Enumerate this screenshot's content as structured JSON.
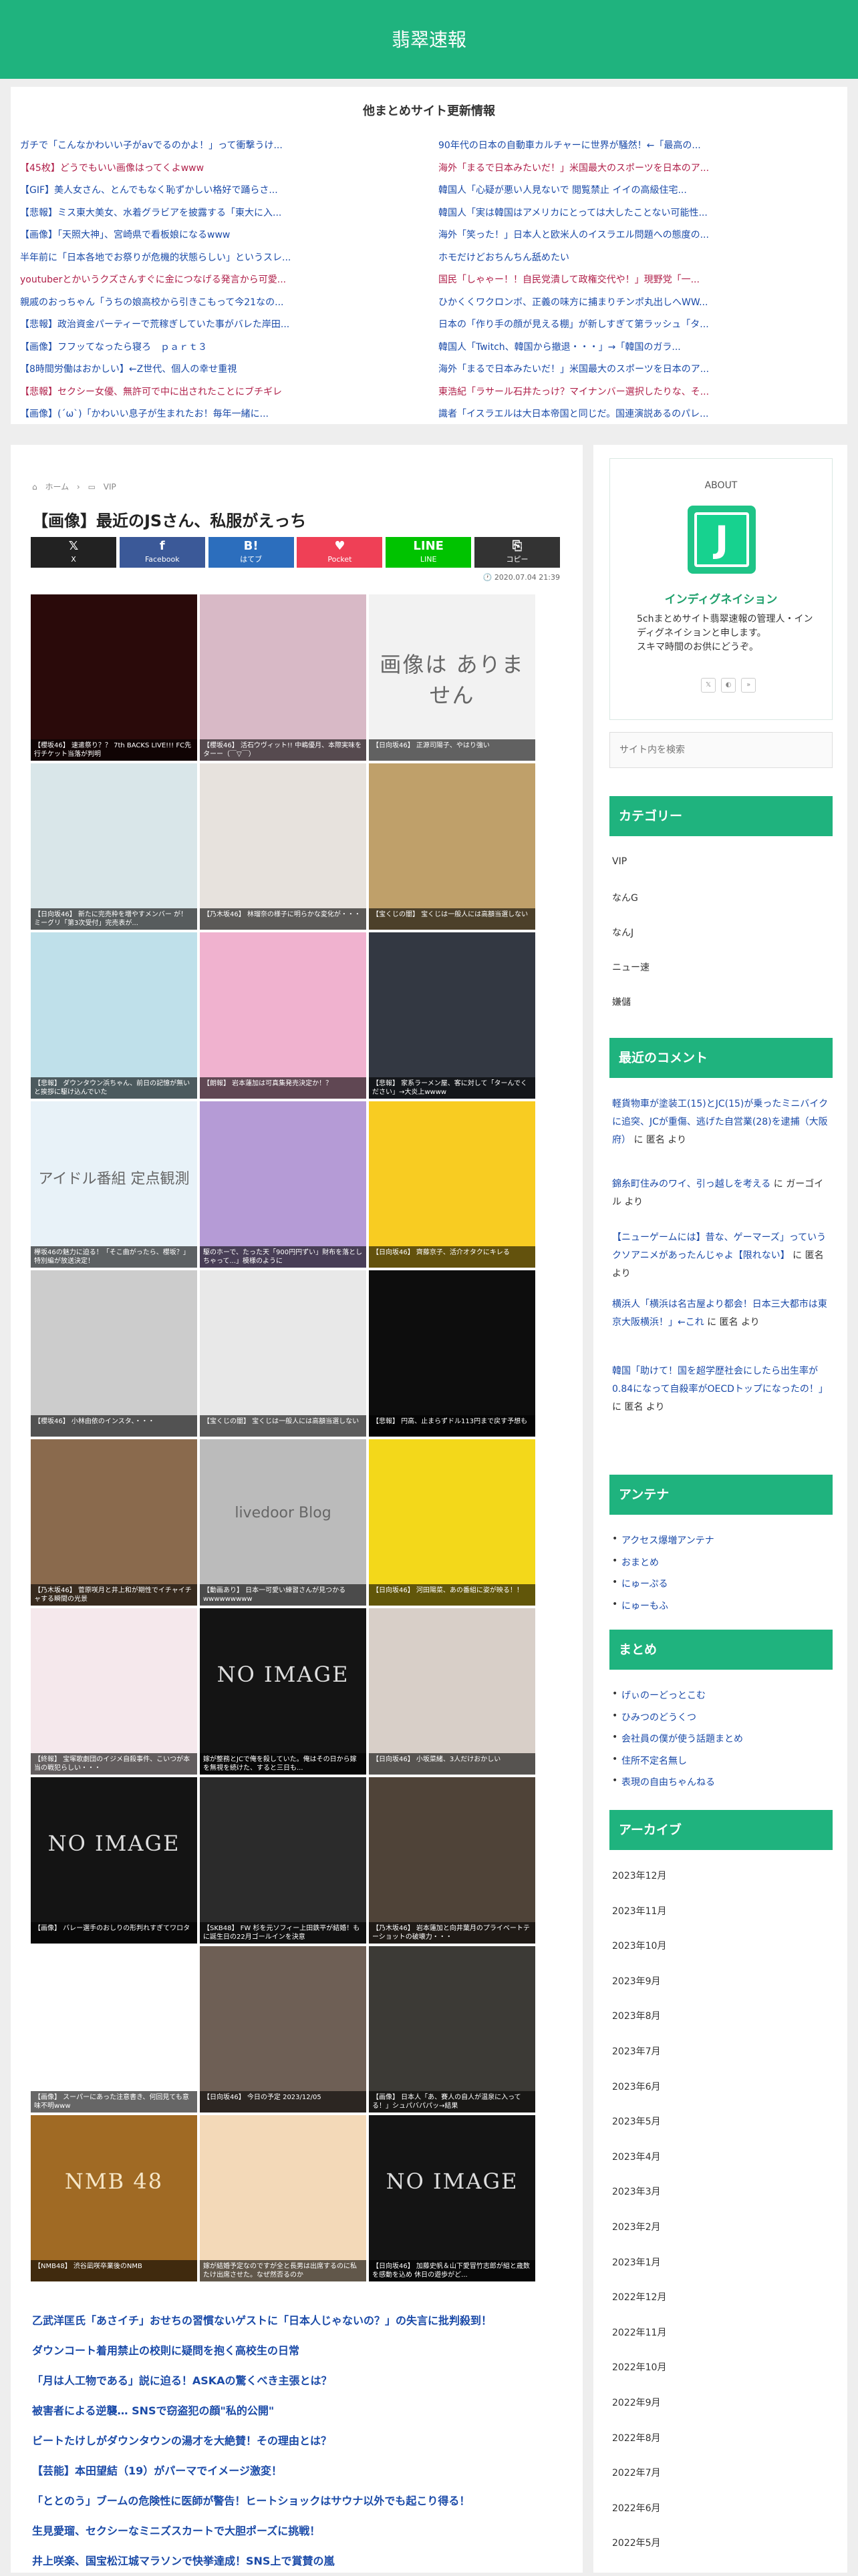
{
  "site": {
    "title": "翡翠速報"
  },
  "rss": {
    "title": "他まとめサイト更新情報",
    "left": [
      "ガチで「こんなかわいい子がavでるのかよ！」って衝撃うけ...",
      "【45枚】どうでもいい画像はってくよwww",
      "【GIF】美人女さん、とんでもなく恥ずかしい格好で踊らさ...",
      "【悲報】ミス東大美女、水着グラビアを披露する「東大に入...",
      "【画像】「天照大神」、宮崎県で看板娘になるwww",
      "半年前に「日本各地でお祭りが危機的状態らしい」というスレ...",
      "youtuberとかいうクズさんすぐに金につなげる発言から可愛...",
      "親戚のおっちゃん「うちの娘高校から引きこもって今21なの...",
      "【悲報】政治資金パーティーで荒稼ぎしていた事がバレた岸田...",
      "【画像】フフッてなったら寝ろ　ｐａｒｔ３",
      "【8時間労働はおかしい】←Z世代、個人の幸せ重視",
      "【悲報】セクシー女優、無許可で中に出されたことにブチギレ",
      "【画像】(´ω`)「かわいい息子が生まれたお！毎年一緒に..."
    ],
    "right": [
      "90年代の日本の自動車カルチャーに世界が騒然！←「最高の...",
      "海外「まるで日本みたいだ！」米国最大のスポーツを日本のア...",
      "韓国人「心疑が悪い人見ないで 閲覧禁止 イイの高級住宅...",
      "韓国人「実は韓国はアメリカにとっては大したことない可能性...",
      "海外「笑った！」日本人と欧米人のイスラエル問題への態度の...",
      "ホモだけどおちんちん舐めたい",
      "国民「しゃゃー！！自民党潰して政権交代や！」現野党「一...",
      "ひかくくワクロンボ、正義の味方に捕まりチンポ丸出しへWW...",
      "日本の「作り手の顔が見える棚」が新しすぎて第ラッシュ「タ...",
      "韓国人「Twitch、韓国から撤退・・・」→「韓国のガラ...",
      "海外「まるで日本みたいだ！」米国最大のスポーツを日本のア...",
      "東浩紀「ラサール石井たっけ？マイナンバー選択したりな、そ...",
      "識者「イスラエルは大日本帝国と同じだ。国連演説あるのパレ..."
    ]
  },
  "post": {
    "breadcrumb": [
      "ホーム",
      "VIP"
    ],
    "title": "【画像】最近のJSさん、私服がえっち",
    "date": "2020.07.04 21:39",
    "share": [
      {
        "icon": "𝕏",
        "label": "X",
        "color": "#222222"
      },
      {
        "icon": "f",
        "label": "Facebook",
        "color": "#3b5998"
      },
      {
        "icon": "B!",
        "label": "はてブ",
        "color": "#2c6ebd"
      },
      {
        "icon": "♥",
        "label": "Pocket",
        "color": "#ef4056"
      },
      {
        "icon": "LINE",
        "label": "LINE",
        "color": "#00c300"
      },
      {
        "icon": "⎘",
        "label": "コピー",
        "color": "#333333"
      }
    ]
  },
  "thumbs": [
    {
      "caption": "【櫻坂46】 速遣祭り？？ 7th BACKS LIVE!!! FC先行チケット当落が判明",
      "bg": "#2a0a0a",
      "text": ""
    },
    {
      "caption": "【櫻坂46】 活石ウヴィット!! 中嶋優月、本際実味を ターー（￣▽￣）",
      "bg": "#d8b9c6",
      "text": ""
    },
    {
      "caption": "【日向坂46】 正源司陽子、やはり強い",
      "bg": "#f2f2f2",
      "text": "画像は ありません"
    },
    {
      "caption": "【日向坂46】 新たに完売枠を増やすメンバー が！ミーグリ「第3次受付」完売表が...",
      "bg": "#d9e6e9",
      "text": ""
    },
    {
      "caption": "【乃木坂46】 林瑠奈の様子に明らかな変化が・・・",
      "bg": "#e7e2dd",
      "text": ""
    },
    {
      "caption": "【宝くじの闇】 宝くじは一般人には高額当選しない",
      "bg": "#bfa06a",
      "text": ""
    },
    {
      "caption": "【悲報】 ダウンタウン浜ちゃん、前日の記憶が無いと挨拶に駆け込んでいた",
      "bg": "#bfe0ea",
      "text": ""
    },
    {
      "caption": "【朗報】 岩本蓮加は可真集発売決定か！？",
      "bg": "#f0b2cf",
      "text": ""
    },
    {
      "caption": "【悲報】 家系ラーメン屋、客に対して「ターんでください」→大炎上wwww",
      "bg": "#333842",
      "text": ""
    },
    {
      "caption": "欅坂46の魅力に迫る！「そこ曲がったら、櫻坂？」特別編が放送決定！",
      "bg": "#e8f2f8",
      "text": "アイドル番組 定点観測"
    },
    {
      "caption": "駆のホーで、たった天「900円円ずい」財布を落としちゃって...」模様のように",
      "bg": "#b59bd6",
      "text": ""
    },
    {
      "caption": "【日向坂46】 齊藤京子、活介オタクにキレる",
      "bg": "#f8cc22",
      "text": ""
    },
    {
      "caption": "【櫻坂46】 小林由依のインスタ、・・・",
      "bg": "#cccccc",
      "text": ""
    },
    {
      "caption": "【宝くじの闇】 宝くじは一般人には高額当選しない",
      "bg": "#e8e8e8",
      "text": ""
    },
    {
      "caption": "【悲報】 円高、止まらずドル113円まで戻す予想も",
      "bg": "#0d0d0d",
      "text": ""
    },
    {
      "caption": "【乃木坂46】 菅原咲月と井上和が期性でイチャイチャする瞬間の光景",
      "bg": "#8a6a4d",
      "text": ""
    },
    {
      "caption": "【動画あり】 日本一可愛い練習さんが見つかるwwwwwwwww",
      "bg": "#bbbbbb",
      "text": "livedoor Blog"
    },
    {
      "caption": "【日向坂46】 河田陽菜、あの番組に姿が映る！！",
      "bg": "#f3d81a",
      "text": ""
    },
    {
      "caption": "【終報】 宝塚歌劇団のイジメ自殺事件、こいつが本当の戦犯らしい・・・",
      "bg": "#f5e8ec",
      "text": ""
    },
    {
      "caption": "嫁が整務とJCで俺を殺していた。俺はその日から嫁を無視を続けた、すると三日も...",
      "bg": "#141414",
      "text": "NO IMAGE"
    },
    {
      "caption": "【日向坂46】 小坂菜緒、3人だけおかしい",
      "bg": "#d8cfc8",
      "text": ""
    },
    {
      "caption": "【画像】 バレー選手のおしりの形判れすぎてワロタ",
      "bg": "#141414",
      "text": "NO IMAGE"
    },
    {
      "caption": "【SKB48】 FW 杉を元ソフィー上田鉄平が結婚！もに誕生日の22月ゴールインを決意",
      "bg": "#2b2b2b",
      "text": ""
    },
    {
      "caption": "【乃木坂46】 岩本蓮加と向井葉月のプライベートテーショットの破壊力・・・",
      "bg": "#4f4338",
      "text": ""
    },
    {
      "caption": "【画像】 スーパーにあった注意書き、何回見ても意味不明www",
      "bg": "#ffffff",
      "text": ""
    },
    {
      "caption": "【日向坂46】 今日の予定 2023/12/05",
      "bg": "#6e5f55",
      "text": ""
    },
    {
      "caption": "【画像】 日本人「あ、賽人の自人が温泉に入ってる！」シュパバパパッ→結果",
      "bg": "#3c3a36",
      "text": ""
    },
    {
      "caption": "【NMB48】 渋谷凪咲卒業後のNMB",
      "bg": "#a06a24",
      "text": "NMB 48"
    },
    {
      "caption": "嫁が結婚予定なのですが全と長男は出席するのに私たけ出席させた。なぜ然否るのか",
      "bg": "#f3d9b8",
      "text": ""
    },
    {
      "caption": "【日向坂46】 加藤史帆＆山下愛冒竹志郎が組と歳数を感動を込め 休日の遊歩がど...",
      "bg": "#141414",
      "text": "NO IMAGE"
    }
  ],
  "related": [
    "乙武洋匡氏「あさイチ」おせちの習慣ないゲストに「日本人じゃないの？」の失言に批判殺到！",
    "ダウンコート着用禁止の校則に疑問を抱く高校生の日常",
    "「月は人工物である」説に迫る！ASKAの驚くべき主張とは？",
    "被害者による逆襲… SNSで窃盗犯の顔\"私的公開\"",
    "ビートたけしがダウンタウンの湯才を大絶賛！その理由とは？",
    "【芸能】本田望結（19）がパーマでイメージ激変！",
    "「ととのう」ブームの危険性に医師が警告！ヒートショックはサウナ以外でも起こり得る！",
    "生見愛瑠、セクシーなミニズスカートで大胆ポーズに挑戦！",
    "井上咲楽、国宝松江城マラソンで快挙達成！SNS上で賞賛の嵐"
  ],
  "sidebar": {
    "about": {
      "heading": "ABOUT",
      "logo_letter": "J",
      "name": "インディグネイション",
      "desc": "5chまとめサイト翡翠速報の管理人・インディグネイションと申します。\nスキマ時間のお供にどうぞ。",
      "icons": [
        "𝕏",
        "◐",
        "»"
      ]
    },
    "search_placeholder": "サイト内を検索",
    "categories_title": "カテゴリー",
    "categories": [
      "VIP",
      "なんG",
      "なんJ",
      "ニュー速",
      "嫌儲"
    ],
    "comments_title": "最近のコメント",
    "comments": [
      {
        "link": "軽貨物車が塗装工(15)とJC(15)が乗ったミニバイクに追突、JCが重傷、逃げた自営業(28)を逮捕（大阪府）",
        "suffix": " に 匿名 より"
      },
      {
        "link": "錦糸町住みのワイ、引っ越しを考える",
        "suffix": " に ガーゴイル より"
      },
      {
        "link": "【ニューゲームには】昔な、ゲーマーズ」っていうクソアニメがあったんじゃよ【限れない】",
        "suffix": " に 匿名 より"
      },
      {
        "link": "横浜人「横浜は名古屋より都会！日本三大都市は東京大阪横浜！」←これ",
        "suffix": " に 匿名 より"
      },
      {
        "link": "韓国「助けて！国を超学歴社会にしたら出生率が0.84になって自殺率がOECDトップになったの！」",
        "suffix": " に 匿名 より"
      }
    ],
    "antenna_title": "アンテナ",
    "antenna": [
      "アクセス爆増アンテナ",
      "おまとめ",
      "にゅーぷる",
      "にゅーもふ"
    ],
    "matome_title": "まとめ",
    "matome": [
      "げぃのーどっとこむ",
      "ひみつのどうくつ",
      "会社員の僕が使う話題まとめ",
      "住所不定名無し",
      "表現の自由ちゃんねる"
    ],
    "archive_title": "アーカイブ",
    "archives": [
      "2023年12月",
      "2023年11月",
      "2023年10月",
      "2023年9月",
      "2023年8月",
      "2023年7月",
      "2023年6月",
      "2023年5月",
      "2023年4月",
      "2023年3月",
      "2023年2月",
      "2023年1月",
      "2022年12月",
      "2022年11月",
      "2022年10月",
      "2022年9月",
      "2022年8月",
      "2022年7月",
      "2022年6月",
      "2022年5月"
    ]
  }
}
